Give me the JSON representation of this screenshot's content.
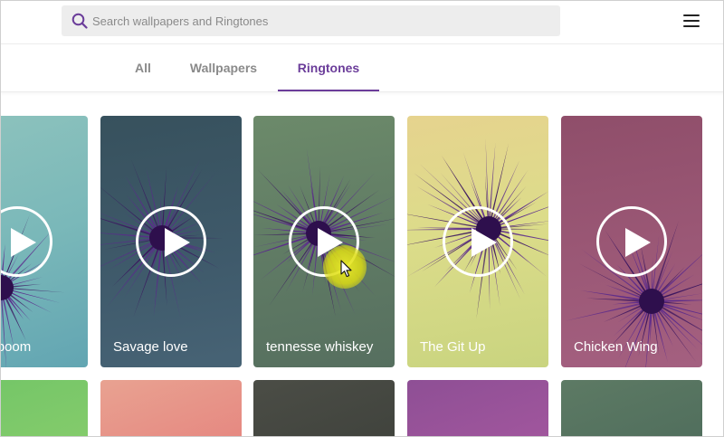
{
  "search": {
    "placeholder": "Search wallpapers and Ringtones"
  },
  "tabs": [
    {
      "label": "All",
      "active": false
    },
    {
      "label": "Wallpapers",
      "active": false
    },
    {
      "label": "Ringtones",
      "active": true
    }
  ],
  "cards": [
    {
      "title": "boom boom"
    },
    {
      "title": "Savage love"
    },
    {
      "title": "tennesse whiskey"
    },
    {
      "title": "The Git Up"
    },
    {
      "title": "Chicken Wing"
    }
  ],
  "colors": {
    "accent": "#6b3d9a",
    "burst": "#5b2a8c"
  },
  "icons": {
    "search": "search-icon",
    "menu": "hamburger-menu-icon",
    "play": "play-icon"
  }
}
